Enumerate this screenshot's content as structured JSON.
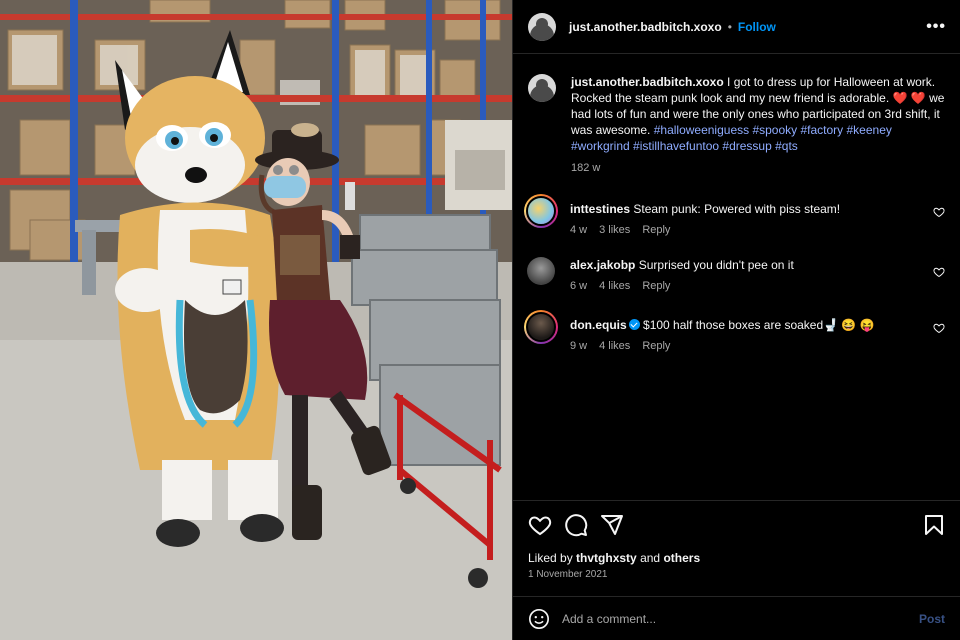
{
  "post": {
    "author": "just.another.badbitch.xoxo",
    "follow_label": "Follow",
    "more_label": "•••",
    "caption_text": "I got to dress up for Halloween at work. Rocked the steam punk look and my new friend is adorable.",
    "caption_hearts": "❤️ ❤️",
    "caption_text_2": "we had lots of fun and were the only ones who participated on 3rd shift, it was awesome.",
    "caption_tags": "#halloweeniguess #spooky #factory #keeney #workgrind #istillhavefuntoo #dressup #qts",
    "caption_age": "182 w"
  },
  "comments": [
    {
      "user": "inttestines",
      "text": "Steam punk: Powered with piss steam!",
      "age": "4 w",
      "likes": "3 likes",
      "reply": "Reply",
      "verified": false
    },
    {
      "user": "alex.jakobp",
      "text": "Surprised you didn't pee on it",
      "age": "6 w",
      "likes": "4 likes",
      "reply": "Reply",
      "verified": false
    },
    {
      "user": "don.equis",
      "text": "$100 half those boxes are soaked🚽 😆 😝",
      "age": "9 w",
      "likes": "4 likes",
      "reply": "Reply",
      "verified": true
    }
  ],
  "footer": {
    "liked_prefix": "Liked by",
    "liked_user": "thvtghxsty",
    "liked_and": "and",
    "liked_others": "others",
    "date": "1 November 2021",
    "comment_placeholder": "Add a comment...",
    "post_label": "Post"
  },
  "icons": {
    "like": "heart-icon",
    "comment": "comment-icon",
    "share": "share-icon",
    "save": "bookmark-icon",
    "emoji": "emoji-icon"
  },
  "colors": {
    "accent": "#0095f6",
    "hashtag": "#8facff",
    "muted": "#a8a8a8"
  }
}
